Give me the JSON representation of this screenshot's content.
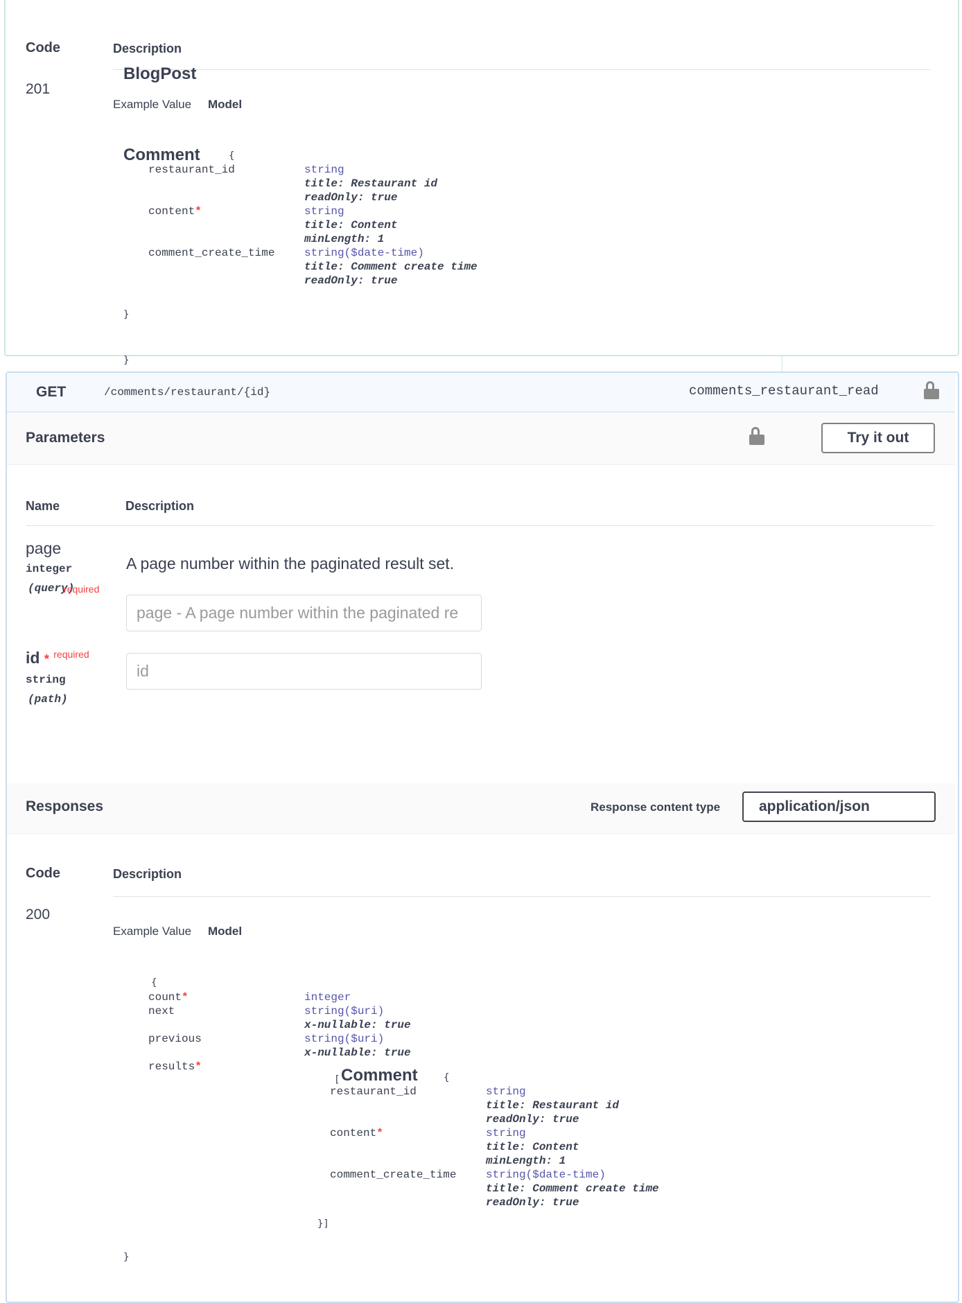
{
  "prev_response": {
    "code_header": "Code",
    "description_header": "Description",
    "code": "201",
    "outer_model_title": "BlogPost",
    "tabs": {
      "example": "Example Value",
      "model": "Model"
    },
    "comment_model": {
      "title": "Comment",
      "open_brace": "{",
      "close_brace": "}",
      "props": [
        {
          "name": "restaurant_id",
          "type": "string",
          "meta": [
            "title: Restaurant id",
            "readOnly: true"
          ]
        },
        {
          "name": "content",
          "required": "*",
          "type": "string",
          "meta": [
            "title: Content",
            "minLength: 1"
          ]
        },
        {
          "name": "comment_create_time",
          "type": "string($date-time)",
          "meta": [
            "title: Comment create time",
            "readOnly: true"
          ]
        }
      ]
    },
    "outer_close_brace": "}"
  },
  "operation": {
    "method": "GET",
    "path": "/comments/restaurant/{id}",
    "operation_id": "comments_restaurant_read",
    "parameters_title": "Parameters",
    "try_button": "Try it out",
    "param_headers": {
      "name": "Name",
      "description": "Description"
    },
    "params": [
      {
        "name": "page",
        "type": "integer",
        "in": "(query)",
        "overlap_label": "required",
        "description": "A page number within the paginated result set.",
        "placeholder": "page - A page number within the paginated re"
      },
      {
        "name": "id",
        "required_star": "*",
        "required_label": "required",
        "type": "string",
        "in": "(path)",
        "placeholder": "id"
      }
    ],
    "responses_title": "Responses",
    "content_type_label": "Response content type",
    "content_type_value": "application/json"
  },
  "response_200": {
    "code_header": "Code",
    "description_header": "Description",
    "code": "200",
    "tabs": {
      "example": "Example Value",
      "model": "Model"
    },
    "open_brace": "{",
    "props": [
      {
        "name": "count",
        "required": "*",
        "type": "integer"
      },
      {
        "name": "next",
        "type": "string($uri)",
        "meta": [
          "x-nullable: true"
        ]
      },
      {
        "name": "previous",
        "type": "string($uri)",
        "meta": [
          "x-nullable: true"
        ]
      },
      {
        "name": "results",
        "required": "*"
      }
    ],
    "results_model": {
      "open": "[",
      "title": "Comment",
      "open_brace": "{",
      "close": "}]",
      "props": [
        {
          "name": "restaurant_id",
          "type": "string",
          "meta": [
            "title: Restaurant id",
            "readOnly: true"
          ]
        },
        {
          "name": "content",
          "required": "*",
          "type": "string",
          "meta": [
            "title: Content",
            "minLength: 1"
          ]
        },
        {
          "name": "comment_create_time",
          "type": "string($date-time)",
          "meta": [
            "title: Comment create time",
            "readOnly: true"
          ]
        }
      ]
    },
    "close_brace": "}"
  }
}
